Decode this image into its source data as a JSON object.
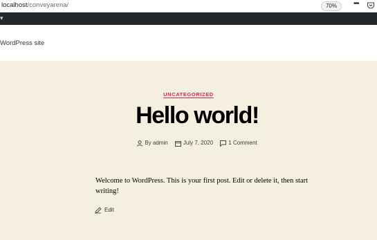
{
  "browser": {
    "url_host": "localhost",
    "url_path": "/conveyarena/",
    "zoom": "70%",
    "icons": [
      "more-icon",
      "pocket-icon"
    ]
  },
  "site": {
    "description": "WordPress site"
  },
  "post": {
    "category": "UNCATEGORIZED",
    "title": "Hello world!",
    "author_label": "By admin",
    "date": "July 7, 2020",
    "comments": "1 Comment",
    "content": "Welcome to WordPress. This is your first post. Edit or delete it, then start writing!",
    "edit_label": "Edit"
  },
  "colors": {
    "accent": "#cd2653",
    "post_background": "#f5efe0",
    "adminbar": "#23282d"
  }
}
